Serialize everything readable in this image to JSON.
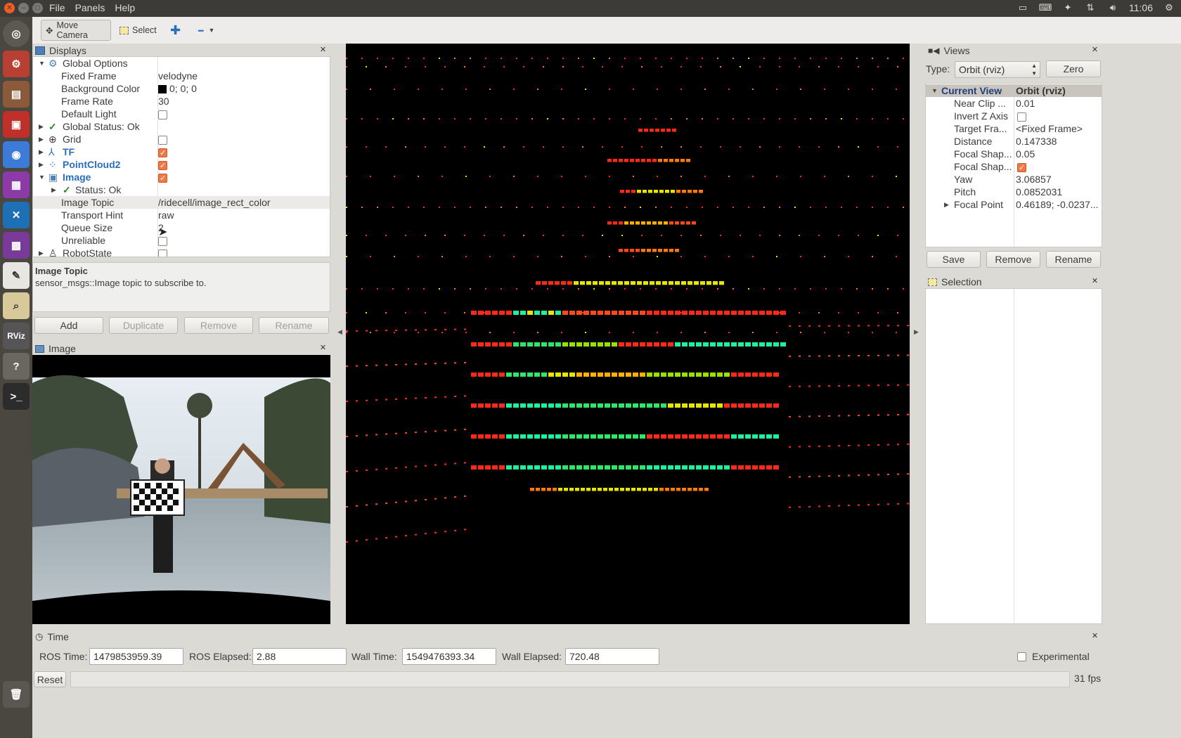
{
  "menubar": {
    "menus": [
      "File",
      "Panels",
      "Help"
    ],
    "clock": "11:06"
  },
  "launcher": {
    "icons": [
      "dash-icon",
      "settings-icon",
      "files-icon",
      "terminal-red-icon",
      "chrome-icon",
      "video-icon",
      "vscode-icon",
      "media-icon",
      "text-editor-icon",
      "search-icon",
      "rviz-icon",
      "help-icon",
      "terminal-icon",
      "trash-icon"
    ],
    "rviz_label": "RViz"
  },
  "toolbar": {
    "move_camera": "Move Camera",
    "select": "Select"
  },
  "displays": {
    "title": "Displays",
    "rows": [
      {
        "label": "Global Options",
        "value": ""
      },
      {
        "label": "Fixed Frame",
        "value": "velodyne"
      },
      {
        "label": "Background Color",
        "value": "0; 0; 0"
      },
      {
        "label": "Frame Rate",
        "value": "30"
      },
      {
        "label": "Default Light",
        "value": ""
      },
      {
        "label": "Global Status: Ok",
        "value": ""
      },
      {
        "label": "Grid",
        "value": ""
      },
      {
        "label": "TF",
        "value": ""
      },
      {
        "label": "PointCloud2",
        "value": ""
      },
      {
        "label": "Image",
        "value": ""
      },
      {
        "label": "Status: Ok",
        "value": ""
      },
      {
        "label": "Image Topic",
        "value": "/ridecell/image_rect_color"
      },
      {
        "label": "Transport Hint",
        "value": "raw"
      },
      {
        "label": "Queue Size",
        "value": "2"
      },
      {
        "label": "Unreliable",
        "value": ""
      },
      {
        "label": "RobotState",
        "value": ""
      }
    ],
    "description_title": "Image Topic",
    "description_text": "sensor_msgs::Image topic to subscribe to.",
    "buttons": {
      "add": "Add",
      "duplicate": "Duplicate",
      "remove": "Remove",
      "rename": "Rename"
    }
  },
  "image_panel": {
    "title": "Image"
  },
  "views": {
    "title": "Views",
    "type_label": "Type:",
    "type_value": "Orbit (rviz)",
    "zero": "Zero",
    "rows": [
      {
        "label": "Current View",
        "value": "Orbit (rviz)"
      },
      {
        "label": "Near Clip ...",
        "value": "0.01"
      },
      {
        "label": "Invert Z Axis",
        "value": ""
      },
      {
        "label": "Target Fra...",
        "value": "<Fixed Frame>"
      },
      {
        "label": "Distance",
        "value": "0.147338"
      },
      {
        "label": "Focal Shap...",
        "value": "0.05"
      },
      {
        "label": "Focal Shap...",
        "value": ""
      },
      {
        "label": "Yaw",
        "value": "3.06857"
      },
      {
        "label": "Pitch",
        "value": "0.0852031"
      },
      {
        "label": "Focal Point",
        "value": "0.46189; -0.0237..."
      }
    ],
    "buttons": {
      "save": "Save",
      "remove": "Remove",
      "rename": "Rename"
    }
  },
  "selection": {
    "title": "Selection"
  },
  "time": {
    "title": "Time",
    "ros_time_label": "ROS Time:",
    "ros_time": "1479853959.39",
    "ros_elapsed_label": "ROS Elapsed:",
    "ros_elapsed": "2.88",
    "wall_time_label": "Wall Time:",
    "wall_time": "1549476393.34",
    "wall_elapsed_label": "Wall Elapsed:",
    "wall_elapsed": "720.48",
    "experimental": "Experimental"
  },
  "statusbar": {
    "reset": "Reset",
    "fps": "31 fps"
  },
  "colors": {
    "accent_orange": "#f07746",
    "link_blue": "#2a6ebb",
    "menubar": "#3c3b37"
  }
}
